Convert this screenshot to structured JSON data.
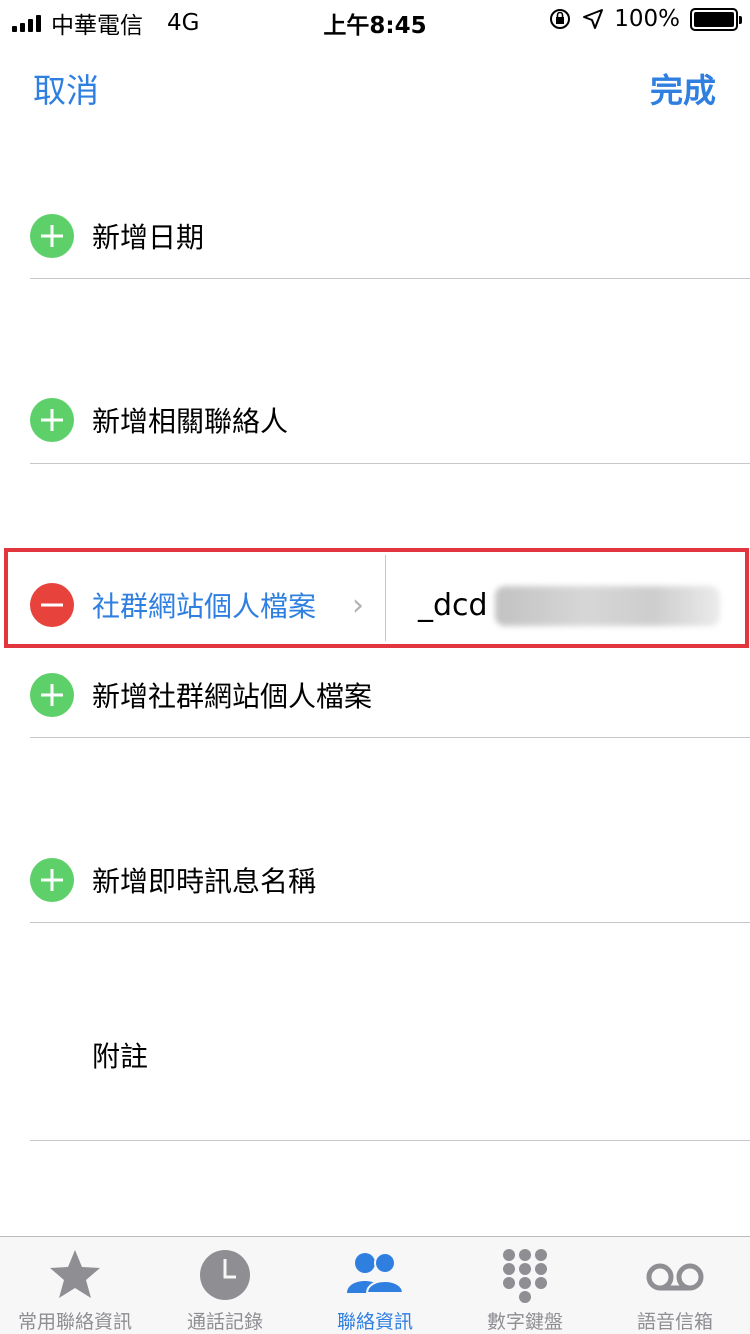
{
  "status_bar": {
    "carrier": "中華電信",
    "network": "4G",
    "time": "上午8:45",
    "battery": "100%"
  },
  "nav": {
    "cancel": "取消",
    "done": "完成"
  },
  "rows": {
    "add_date": "新增日期",
    "add_related": "新增相關聯絡人",
    "social_profile_label": "社群網站個人檔案",
    "social_profile_value": "_dcd",
    "add_social_profile": "新增社群網站個人檔案",
    "add_im": "新增即時訊息名稱",
    "notes": "附註"
  },
  "tabs": [
    {
      "label": "常用聯絡資訊",
      "icon": "star-icon"
    },
    {
      "label": "通話記錄",
      "icon": "clock-icon"
    },
    {
      "label": "聯絡資訊",
      "icon": "contacts-icon"
    },
    {
      "label": "數字鍵盤",
      "icon": "keypad-icon"
    },
    {
      "label": "語音信箱",
      "icon": "voicemail-icon"
    }
  ],
  "colors": {
    "accent": "#2f7fe0",
    "add_green": "#5dd06a",
    "remove_red": "#e8423c",
    "highlight_red": "#e2363f"
  }
}
